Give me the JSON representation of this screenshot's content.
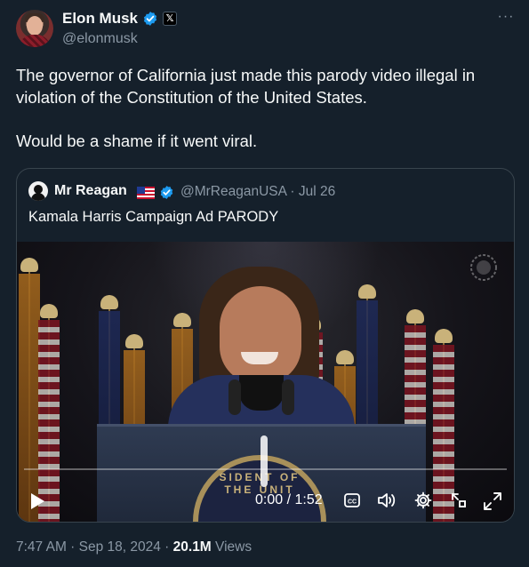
{
  "author": {
    "name": "Elon Musk",
    "handle": "@elonmusk",
    "affiliation_badge": "𝕏",
    "verified_color": "#1d9bf0"
  },
  "more_label": "···",
  "tweet": {
    "text": "The governor of California just made this parody video illegal in violation of the Constitution of the United States.\n\nWould be a shame if it went viral."
  },
  "quoted": {
    "name": "Mr Reagan",
    "handle_date": "@MrReaganUSA · Jul 26",
    "text": "Kamala Harris Campaign Ad PARODY",
    "flag_icon": "us-flag-icon",
    "video": {
      "podium_seal_text": "SIDENT OF THE UNIT",
      "time": "0:00 / 1:52",
      "progress": 0.0,
      "controls": [
        "play-icon",
        "captions-icon",
        "volume-icon",
        "settings-icon",
        "pip-icon",
        "fullscreen-icon"
      ]
    }
  },
  "footer": {
    "timestamp": "7:47 AM · Sep 18, 2024 · ",
    "views_count": "20.1M",
    "views_label": " Views"
  },
  "colors": {
    "background": "#15202b",
    "text": "#f7f9f9",
    "muted": "#8b98a5",
    "border": "#38444d",
    "accent": "#1d9bf0"
  }
}
